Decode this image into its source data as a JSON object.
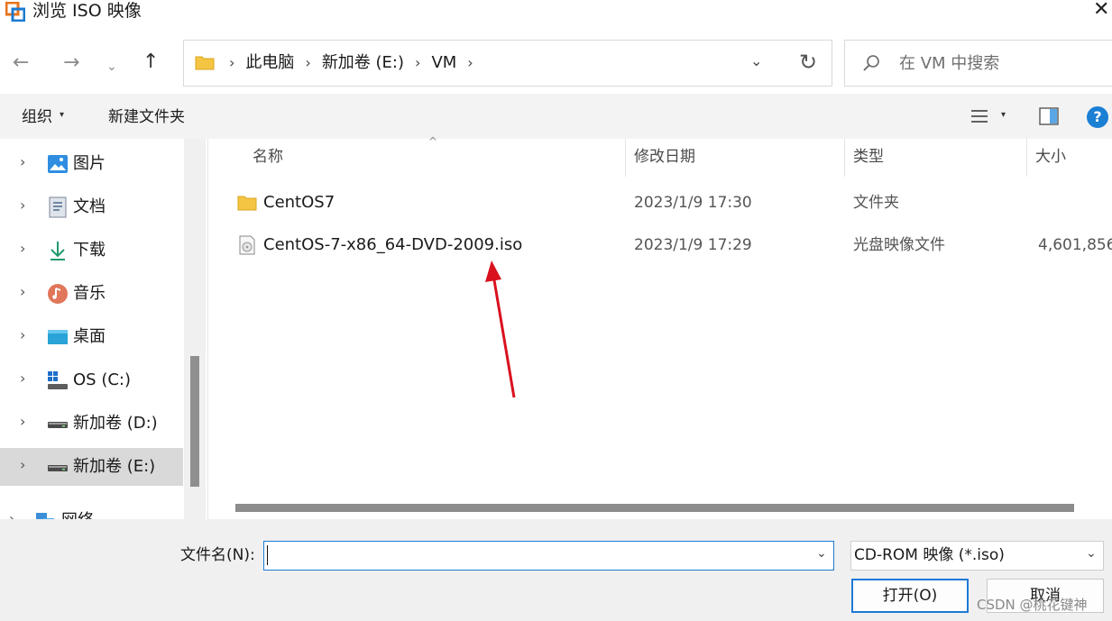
{
  "window": {
    "title": "浏览 ISO 映像",
    "close_glyph": "✕"
  },
  "nav": {
    "back": "←",
    "forward": "→",
    "recent": "⌄",
    "up": "↑"
  },
  "address": {
    "crumbs": [
      "此电脑",
      "新加卷 (E:)",
      "VM"
    ],
    "separator": "›",
    "dropdown": "⌄",
    "refresh": "↻"
  },
  "search": {
    "placeholder": "在 VM 中搜索"
  },
  "toolbar": {
    "organize_label": "组织",
    "organize_caret": "▾",
    "newfolder_label": "新建文件夹",
    "view_caret": "▾",
    "help": "?"
  },
  "sidebar": {
    "chevron": "›",
    "items": [
      {
        "label": "图片",
        "icon": "pictures-icon"
      },
      {
        "label": "文档",
        "icon": "documents-icon"
      },
      {
        "label": "下载",
        "icon": "downloads-icon"
      },
      {
        "label": "音乐",
        "icon": "music-icon"
      },
      {
        "label": "桌面",
        "icon": "desktop-icon"
      },
      {
        "label": "OS (C:)",
        "icon": "windows-drive-icon"
      },
      {
        "label": "新加卷 (D:)",
        "icon": "drive-icon"
      },
      {
        "label": "新加卷 (E:)",
        "icon": "drive-icon",
        "selected": true
      },
      {
        "label": "网络",
        "icon": "network-icon"
      }
    ]
  },
  "columns": {
    "name": "名称",
    "modified": "修改日期",
    "type": "类型",
    "size": "大小",
    "sort_caret": "^"
  },
  "files": [
    {
      "name": "CentOS7",
      "modified": "2023/1/9 17:30",
      "type": "文件夹",
      "size": "",
      "icon": "folder-icon"
    },
    {
      "name": "CentOS-7-x86_64-DVD-2009.iso",
      "modified": "2023/1/9 17:29",
      "type": "光盘映像文件",
      "size": "4,601,856",
      "icon": "disc-image-icon"
    }
  ],
  "footer": {
    "filename_label": "文件名(N):",
    "filename_value": "",
    "filename_dd": "⌄",
    "filter_label": "CD-ROM 映像 (*.iso)",
    "filter_dd": "⌄",
    "open_label": "打开(O)",
    "cancel_label": "取消"
  },
  "watermark": "CSDN @桃花键神",
  "colors": {
    "accent": "#1e7ad6",
    "annotation_arrow": "#d9111e"
  }
}
